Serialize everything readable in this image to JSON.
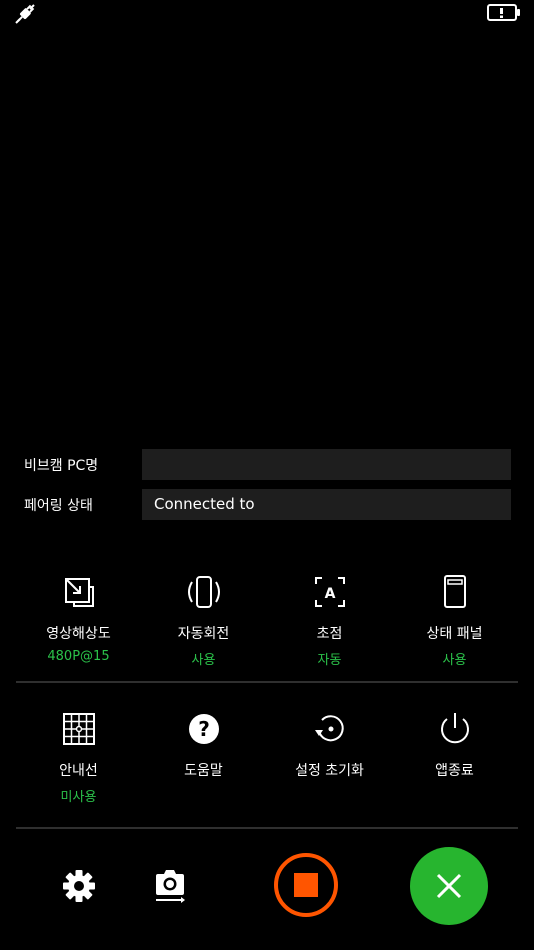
{
  "info": {
    "pc_name_label": "비브캠 PC명",
    "pc_name_value": "",
    "pairing_label": "페어링 상태",
    "pairing_value": "Connected to"
  },
  "settings_row1": [
    {
      "label": "영상해상도",
      "value": "480P@15",
      "icon": "resolution-icon"
    },
    {
      "label": "자동회전",
      "value": "사용",
      "icon": "rotate-device-icon"
    },
    {
      "label": "초점",
      "value": "자동",
      "icon": "autofocus-icon"
    },
    {
      "label": "상태 패널",
      "value": "사용",
      "icon": "status-panel-icon"
    }
  ],
  "settings_row2": [
    {
      "label": "안내선",
      "value": "미사용",
      "icon": "grid-lines-icon"
    },
    {
      "label": "도움말",
      "value": "",
      "icon": "help-icon"
    },
    {
      "label": "설정 초기화",
      "value": "",
      "icon": "reset-icon"
    },
    {
      "label": "앱종료",
      "value": "",
      "icon": "power-icon"
    }
  ],
  "colors": {
    "accent_green": "#2bc24a",
    "record_orange": "#ff5500",
    "close_green": "#27b52f"
  },
  "bottom_bar": [
    "gear-icon",
    "camera-switch-icon",
    "stop-record-button",
    "close-button"
  ]
}
